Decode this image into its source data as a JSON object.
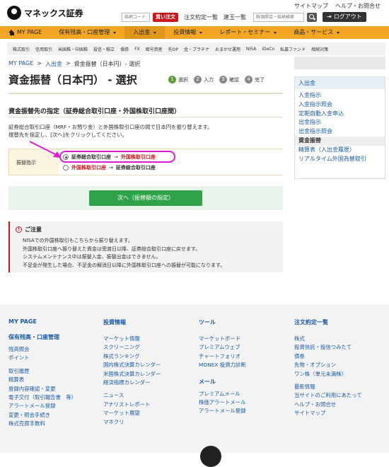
{
  "header": {
    "logo_text": "マネックス証券",
    "top_links": [
      "サイトマップ",
      "ヘルプ・お問合せ"
    ],
    "code_placeholder": "銘柄コード",
    "buy_button": "買い注文",
    "link_orders": "注文約定一覧",
    "link_positions": "建玉一覧",
    "search_placeholder": "株価照会・銘柄検索",
    "logout": "ログアウト"
  },
  "mainnav": [
    {
      "label": "MY PAGE"
    },
    {
      "label": "保有残高・口座管理"
    },
    {
      "label": "入出金"
    },
    {
      "label": "投資情報"
    },
    {
      "label": "レポート・セミナー"
    },
    {
      "label": "商品・サービス"
    }
  ],
  "subnav": [
    "株式取引",
    "信用取引",
    "米国株・中国株",
    "投信・積立",
    "債券",
    "FX",
    "暗号資産",
    "先OP",
    "金・プラチナ",
    "おまかせ運用",
    "NISA",
    "iDeCo",
    "私募ファンド",
    "相続対策"
  ],
  "breadcrumb": [
    "MY PAGE",
    ">",
    "入出金",
    ">",
    "資金振替（日本円）- 選択"
  ],
  "page_title": "資金振替（日本円） - 選択",
  "steps": [
    {
      "num": "1",
      "label": "選択"
    },
    {
      "num": "2",
      "label": "入力"
    },
    {
      "num": "3",
      "label": "確認"
    },
    {
      "num": "4",
      "label": "完了"
    }
  ],
  "side": {
    "head": "入出金",
    "items": [
      "入金指示",
      "入金指示照会",
      "定期自動入金申込",
      "出金指示",
      "出金指示照会",
      "資金振替",
      "精算表（入出金履歴）",
      "リアルタイム外国為替取引"
    ]
  },
  "section_title": "資金振替先の指定（証券総合取引口座・外国株取引口座間）",
  "desc": [
    "証券総合取引口座（MRF・お預り金）と外国株取引口座の間で日本円を振り替えます。",
    "振替先を指定し、[次へ]をクリックしてください。"
  ],
  "transfer": {
    "label": "振替指示",
    "option1": {
      "from": "証券総合取引口座",
      "arrow": "→",
      "to": "外国株取引口座"
    },
    "option2": {
      "from": "外国株取引口座",
      "arrow": "→",
      "to": "証券総合取引口座"
    }
  },
  "next_button": "次へ（振替額の指定）",
  "notice": {
    "title": "ご注意",
    "lines": [
      "NISAでの外国株取引もこちらから振り替えます。",
      "外国株取引口座へ振り替えた資金は受渡日以降、証券総合取引口座に戻せます。",
      "システムメンテナンス中は振替入金、振替出金はできません。",
      "不足金が発生した場合、不足金の解消日以降に外国株取引口座への振替が可能になります。"
    ]
  },
  "footer": {
    "col1": {
      "head": "MY PAGE",
      "head2": "保有残高・口座管理",
      "links_a": [
        "残高照会",
        "ポイント"
      ],
      "links_b": [
        "取引履歴",
        "精算表",
        "登録内容確認・変更",
        "電子交付（取引報告書　等）",
        "アラートメール登録",
        "変更・照会手続き",
        "株式売買手数料"
      ]
    },
    "col2": {
      "head": "投資情報",
      "links_a": [
        "マーケット情報",
        "スクリーニング",
        "株式ランキング",
        "国内株式決算カレンダー",
        "米国株式決算カレンダー",
        "経済指標カレンダー"
      ],
      "links_b": [
        "ニュース",
        "アナリストレポート",
        "マーケット展望",
        "マネクリ"
      ]
    },
    "col3": {
      "head": "ツール",
      "links_a": [
        "マーケットボード",
        "プレミアムウェブ",
        "チャートフォリオ",
        "MONEX 投資力診断"
      ],
      "head2": "メール",
      "links_b": [
        "プレミアムメール",
        "株価アラートメール",
        "アラートメール登録"
      ]
    },
    "col4": {
      "head": "注文約定一覧",
      "links_a": [
        "株式",
        "投資信託・投信つみたて",
        "債券",
        "先物・オプション",
        "ワン株（単元未満株）"
      ],
      "links_b": [
        "最新情報",
        "当サイトのご利用にあたって",
        "ヘルプ・お問合せ",
        "サイトマップ"
      ]
    }
  }
}
